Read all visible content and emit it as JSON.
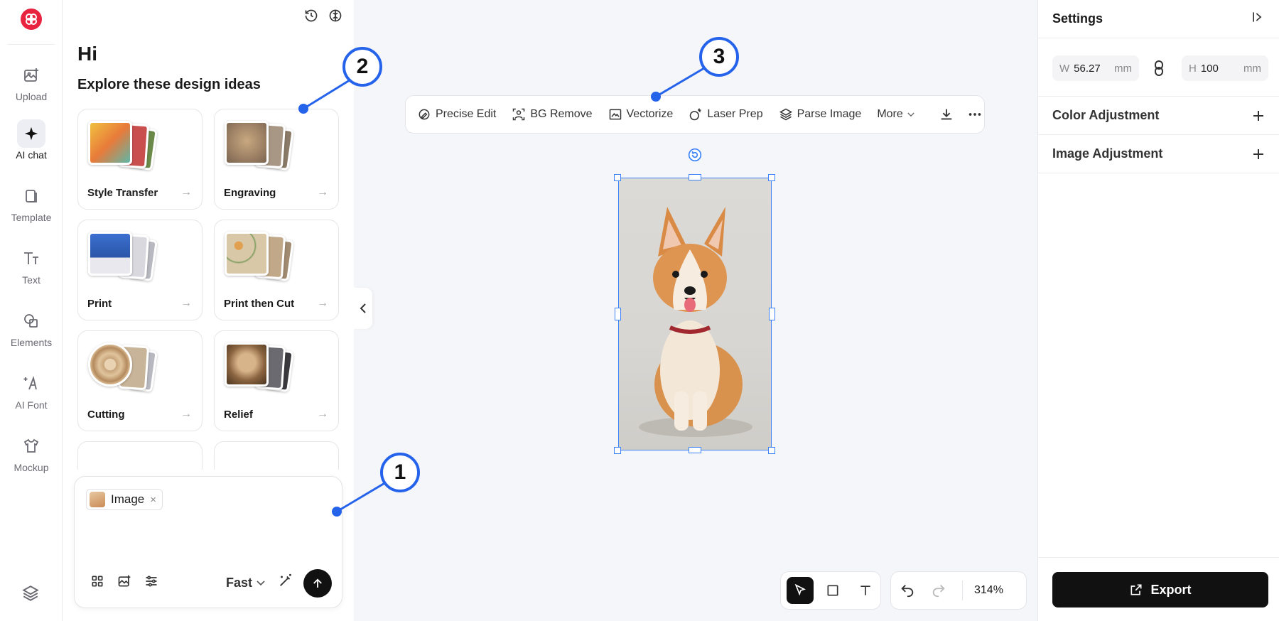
{
  "rail": {
    "items": [
      {
        "label": "Upload"
      },
      {
        "label": "AI chat"
      },
      {
        "label": "Template"
      },
      {
        "label": "Text"
      },
      {
        "label": "Elements"
      },
      {
        "label": "AI Font"
      },
      {
        "label": "Mockup"
      }
    ]
  },
  "chat": {
    "greeting": "Hi",
    "subtitle": "Explore these design ideas",
    "cards": [
      {
        "label": "Style Transfer",
        "arrow": "→"
      },
      {
        "label": "Engraving",
        "arrow": "→"
      },
      {
        "label": "Print",
        "arrow": "→"
      },
      {
        "label": "Print then Cut",
        "arrow": "→"
      },
      {
        "label": "Cutting",
        "arrow": "→"
      },
      {
        "label": "Relief",
        "arrow": "→"
      }
    ],
    "composer": {
      "chip_label": "Image",
      "chip_close": "×",
      "mode": "Fast"
    }
  },
  "toolbar": {
    "items": [
      "Precise Edit",
      "BG Remove",
      "Vectorize",
      "Laser Prep",
      "Parse Image"
    ],
    "more": "More"
  },
  "bottom": {
    "zoom": "314%"
  },
  "settings": {
    "title": "Settings",
    "width": {
      "key": "W",
      "value": "56.27",
      "unit": "mm"
    },
    "height": {
      "key": "H",
      "value": "100",
      "unit": "mm"
    },
    "sections": [
      "Color Adjustment",
      "Image Adjustment"
    ],
    "export_label": "Export"
  },
  "callouts": [
    "1",
    "2",
    "3"
  ],
  "colors": {
    "accent": "#2563eb",
    "brand": "#e8233f",
    "selection": "#3b82f6"
  }
}
